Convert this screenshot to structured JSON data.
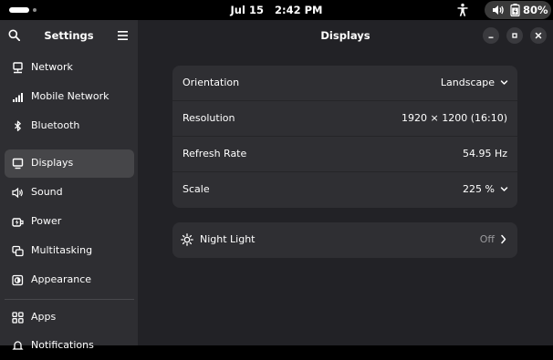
{
  "topbar": {
    "date": "Jul 15",
    "time": "2:42 PM",
    "battery": "80%"
  },
  "sidebar": {
    "title": "Settings",
    "items": [
      {
        "label": "Network",
        "icon": "network-icon"
      },
      {
        "label": "Mobile Network",
        "icon": "signal-bars-icon"
      },
      {
        "label": "Bluetooth",
        "icon": "bluetooth-icon"
      },
      {
        "label": "Displays",
        "icon": "display-icon",
        "active": true
      },
      {
        "label": "Sound",
        "icon": "speaker-icon"
      },
      {
        "label": "Power",
        "icon": "power-icon"
      },
      {
        "label": "Multitasking",
        "icon": "multitasking-icon"
      },
      {
        "label": "Appearance",
        "icon": "appearance-icon"
      },
      {
        "label": "Apps",
        "icon": "apps-grid-icon"
      },
      {
        "label": "Notifications",
        "icon": "bell-icon"
      }
    ]
  },
  "content": {
    "title": "Displays",
    "rows": [
      {
        "label": "Orientation",
        "value": "Landscape"
      },
      {
        "label": "Resolution",
        "value": "1920 × 1200 (16:10)"
      },
      {
        "label": "Refresh Rate",
        "value": "54.95 Hz"
      },
      {
        "label": "Scale",
        "value": "225 %"
      }
    ],
    "night_light": {
      "label": "Night Light",
      "value": "Off"
    }
  }
}
